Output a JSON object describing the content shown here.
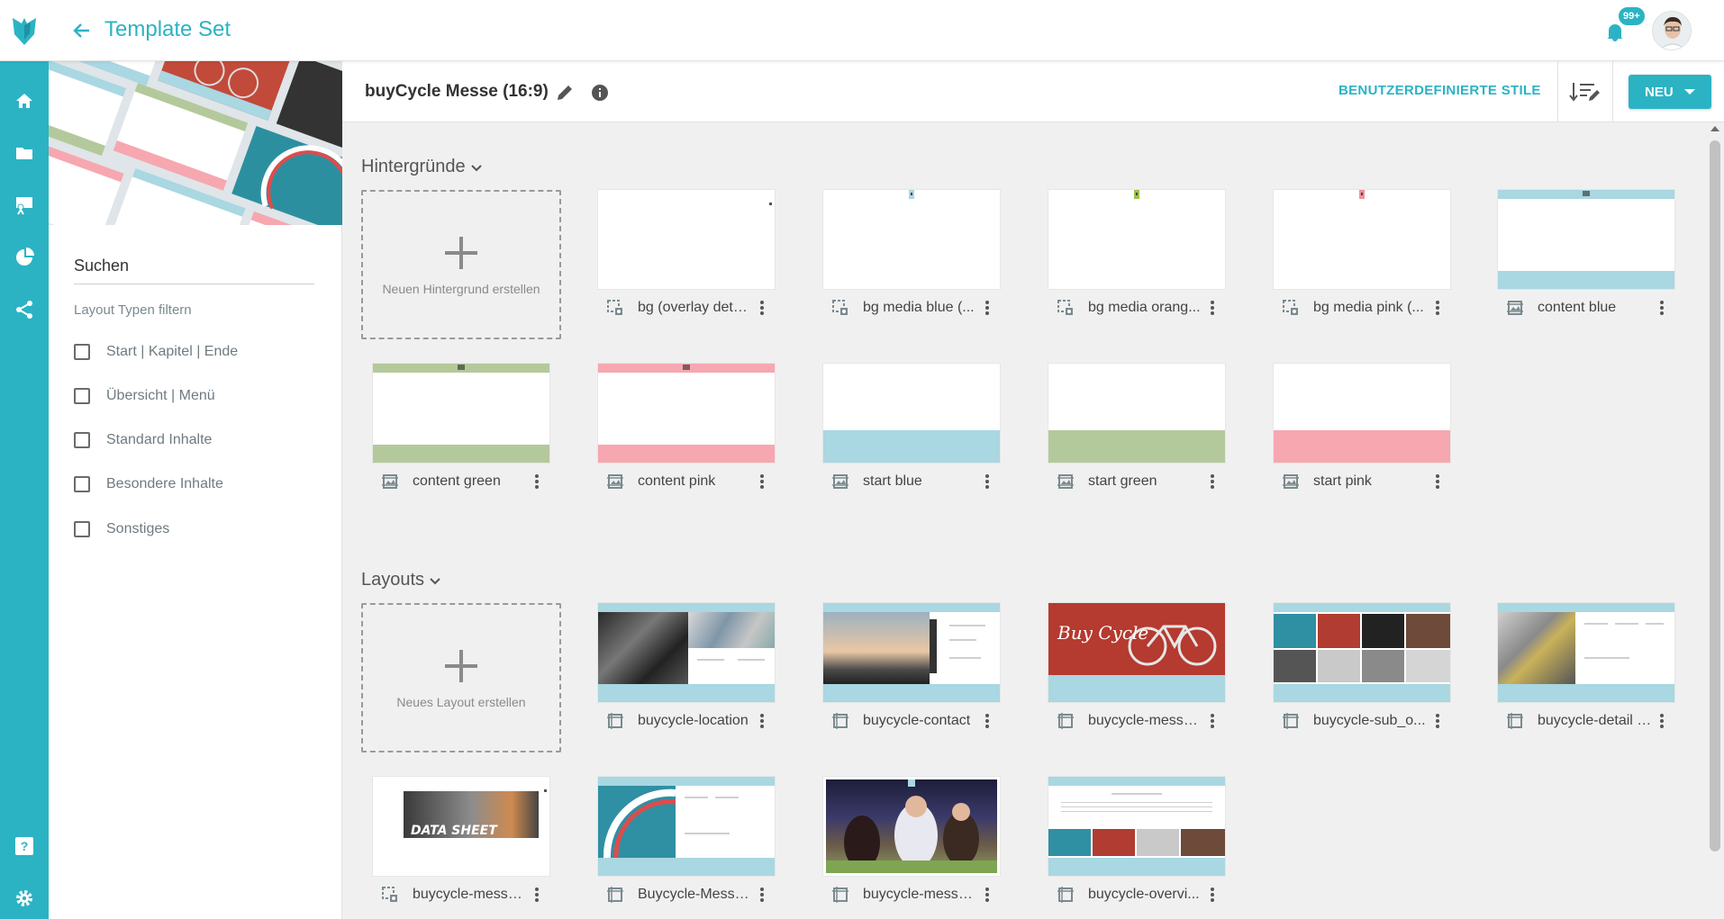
{
  "app": {
    "title": "Template Set"
  },
  "notifications": {
    "badge": "99+"
  },
  "nav": {
    "items": [
      "home",
      "folder",
      "presentation",
      "analytics",
      "share"
    ],
    "bottom": [
      "help",
      "settings"
    ]
  },
  "filter": {
    "search_placeholder": "Suchen",
    "label": "Layout Typen filtern",
    "options": [
      "Start | Kapitel | Ende",
      "Übersicht | Menü",
      "Standard Inhalte",
      "Besondere Inhalte",
      "Sonstiges"
    ]
  },
  "header": {
    "set_name": "buyCycle Messe (16:9)",
    "custom_styles": "BENUTZERDEFINIERTE STILE",
    "new_button": "NEU"
  },
  "backgrounds": {
    "title": "Hintergründe",
    "create_label": "Neuen Hintergrund erstellen",
    "items": [
      {
        "name": "bg (overlay deta..."
      },
      {
        "name": "bg media blue (..."
      },
      {
        "name": "bg media orang..."
      },
      {
        "name": "bg media pink (..."
      },
      {
        "name": "content blue"
      },
      {
        "name": "content green"
      },
      {
        "name": "content pink"
      },
      {
        "name": "start blue"
      },
      {
        "name": "start green"
      },
      {
        "name": "start pink"
      }
    ]
  },
  "layouts": {
    "title": "Layouts",
    "create_label": "Neues Layout erstellen",
    "items": [
      {
        "name": "buycycle-location"
      },
      {
        "name": "buycycle-contact"
      },
      {
        "name": "buycycle-messe..."
      },
      {
        "name": "buycycle-sub_o..."
      },
      {
        "name": "buycycle-detail (..."
      },
      {
        "name": "buycycle-messe..."
      },
      {
        "name": "Buycycle-Messe..."
      },
      {
        "name": "buycycle-messe..."
      },
      {
        "name": "buycycle-overvi..."
      }
    ],
    "thumb_text": {
      "data_sheet": "DATA SHEET",
      "bike_script": "Buy Cycle"
    }
  },
  "colors": {
    "accent": "#2bb3c4",
    "blue": "#a9d7e2",
    "green": "#b4c99b",
    "pink": "#f6a7b0",
    "orange": "#9cc24a"
  }
}
